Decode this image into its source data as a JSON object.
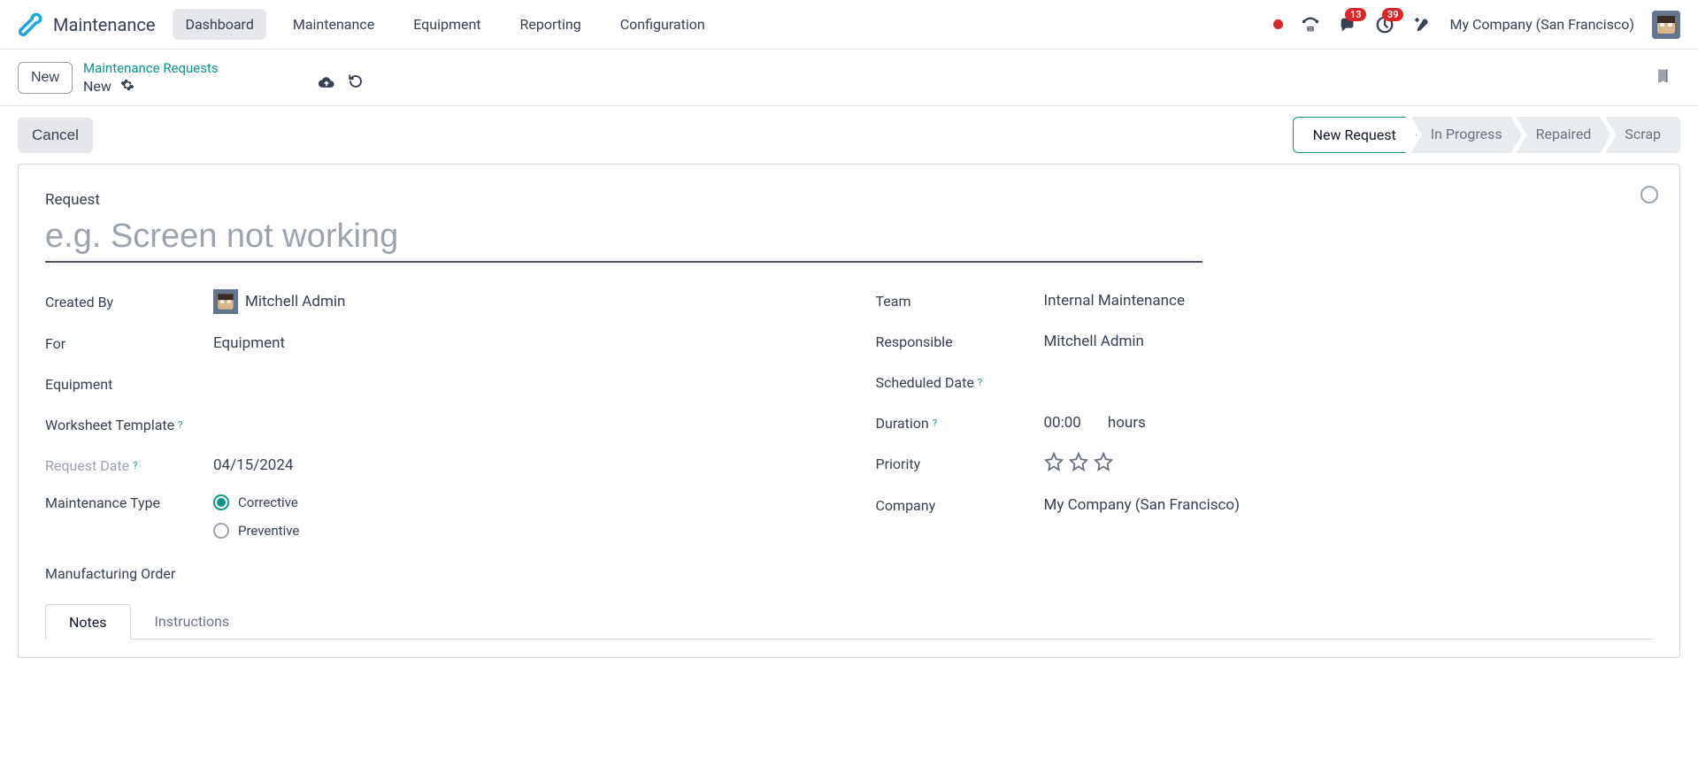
{
  "app": {
    "title": "Maintenance"
  },
  "nav": {
    "tabs": [
      "Dashboard",
      "Maintenance",
      "Equipment",
      "Reporting",
      "Configuration"
    ],
    "active_index": 0,
    "badges": {
      "messages": "13",
      "activities": "39"
    },
    "company": "My Company (San Francisco)"
  },
  "breadcrumb": {
    "new_button": "New",
    "link": "Maintenance Requests",
    "current": "New"
  },
  "actions": {
    "cancel": "Cancel"
  },
  "status": {
    "steps": [
      "New Request",
      "In Progress",
      "Repaired",
      "Scrap"
    ],
    "active_index": 0
  },
  "form": {
    "request_label": "Request",
    "request_placeholder": "e.g. Screen not working",
    "request_value": "",
    "left": {
      "created_by": {
        "label": "Created By",
        "value": "Mitchell Admin"
      },
      "for": {
        "label": "For",
        "value": "Equipment"
      },
      "equipment": {
        "label": "Equipment",
        "value": ""
      },
      "worksheet_template": {
        "label": "Worksheet Template",
        "value": ""
      },
      "request_date": {
        "label": "Request Date",
        "value": "04/15/2024"
      },
      "maintenance_type": {
        "label": "Maintenance Type",
        "options": {
          "corrective": "Corrective",
          "preventive": "Preventive"
        },
        "selected": "corrective"
      },
      "manufacturing_order": {
        "label": "Manufacturing Order",
        "value": ""
      }
    },
    "right": {
      "team": {
        "label": "Team",
        "value": "Internal Maintenance"
      },
      "responsible": {
        "label": "Responsible",
        "value": "Mitchell Admin"
      },
      "scheduled_date": {
        "label": "Scheduled Date",
        "value": ""
      },
      "duration": {
        "label": "Duration",
        "value": "00:00",
        "unit": "hours"
      },
      "priority": {
        "label": "Priority",
        "stars": 3,
        "rating": 0
      },
      "company": {
        "label": "Company",
        "value": "My Company (San Francisco)"
      }
    }
  },
  "tabs": {
    "items": [
      "Notes",
      "Instructions"
    ],
    "active_index": 0
  },
  "colors": {
    "teal": "#0d9488",
    "red": "#dc2626"
  }
}
